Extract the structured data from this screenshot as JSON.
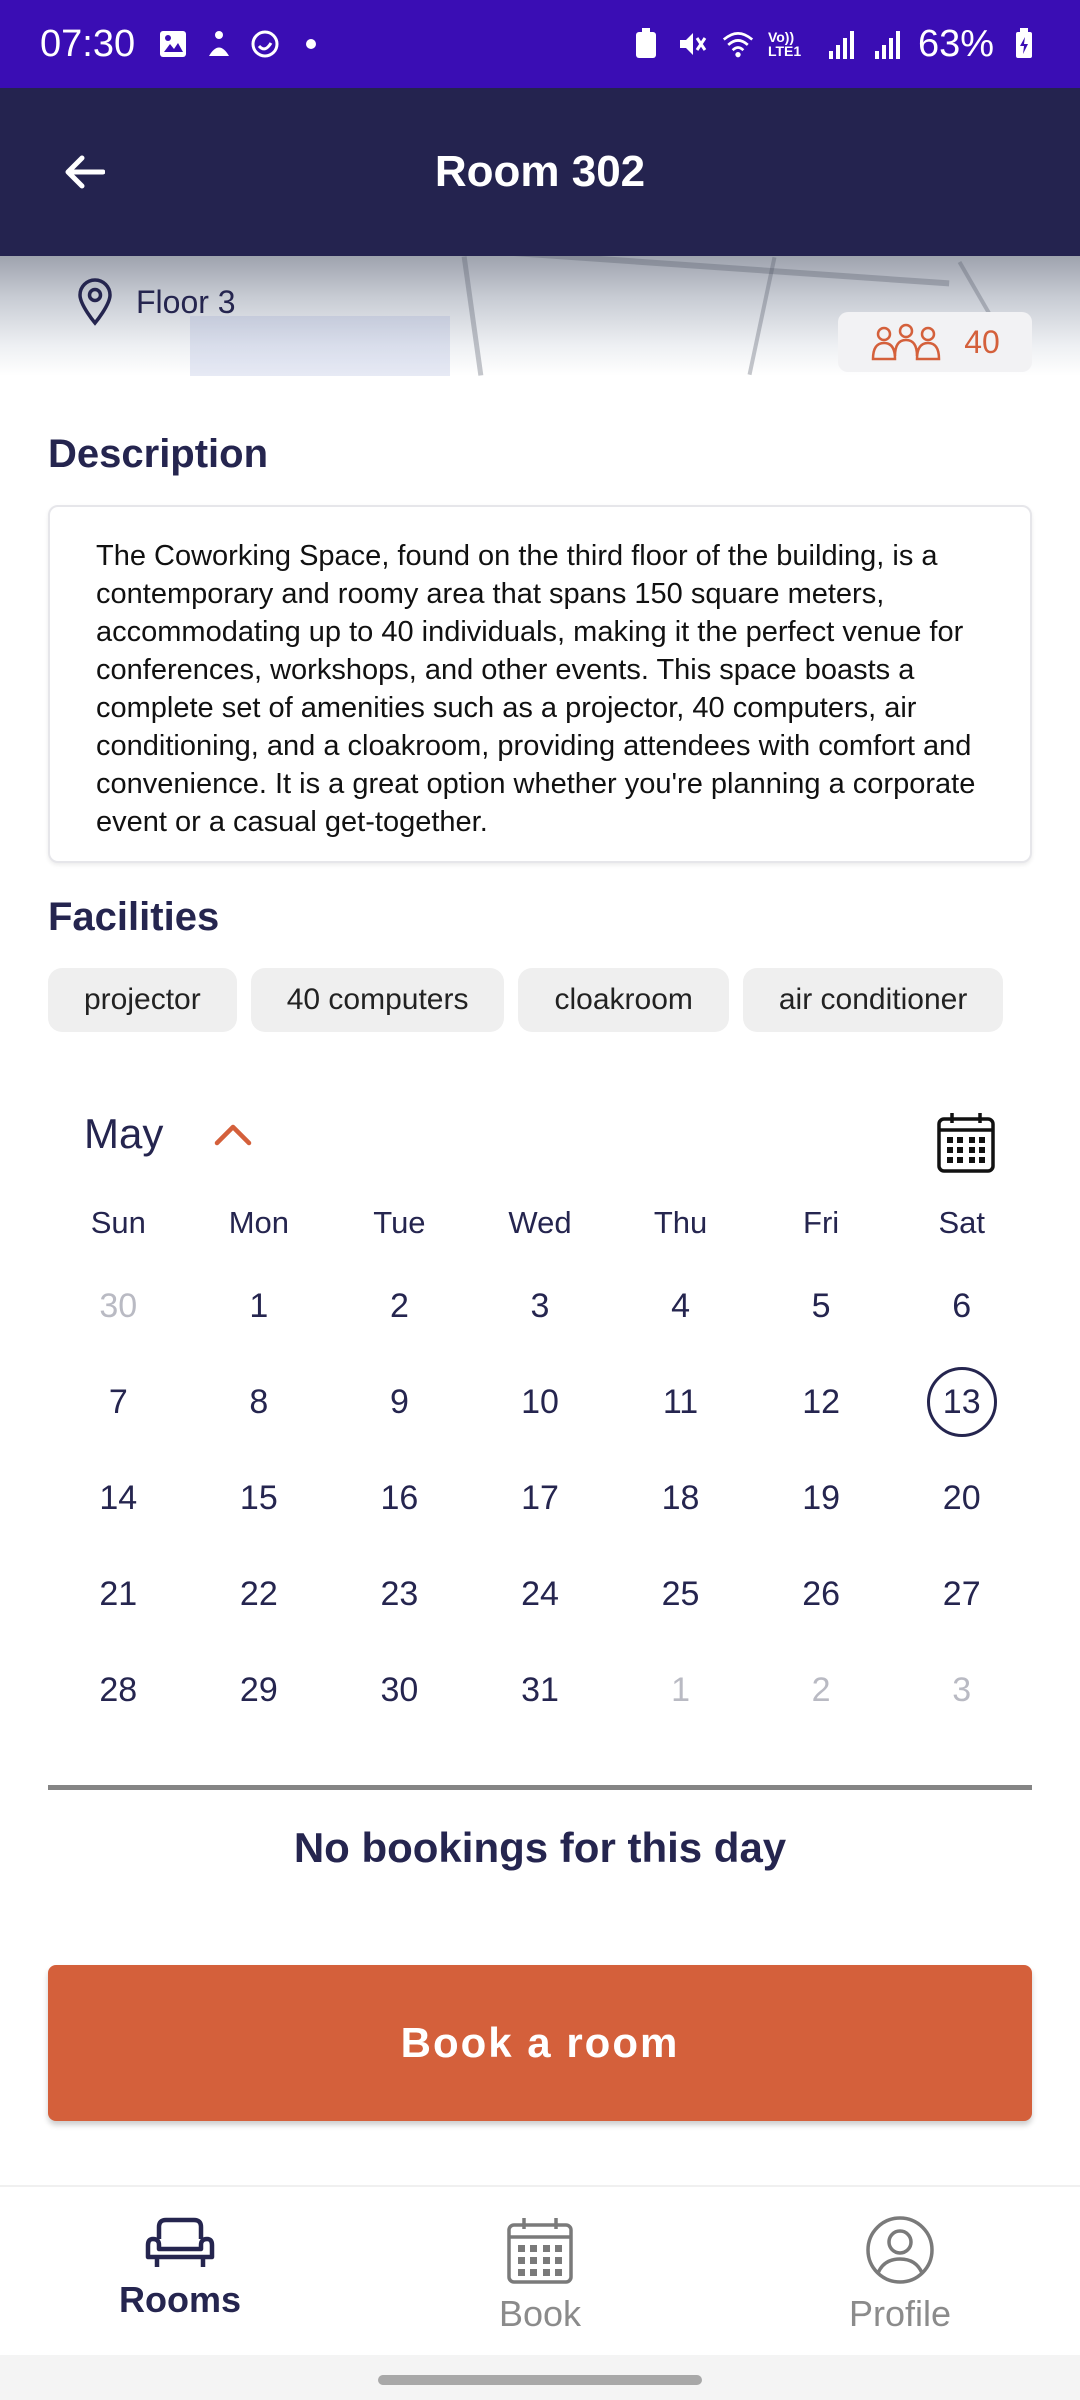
{
  "status_bar": {
    "time": "07:30",
    "battery": "63%",
    "volte_label": "Vo)) LTE1"
  },
  "header": {
    "title": "Room 302"
  },
  "room": {
    "floor": "Floor 3",
    "capacity": "40"
  },
  "description": {
    "title": "Description",
    "text": "The Coworking Space, found on the third floor of the building, is a contemporary and roomy area that spans 150 square meters, accommodating up to 40 individuals, making it the perfect venue for conferences, workshops, and other events. This space boasts a complete set of amenities such as a projector, 40 computers, air conditioning, and a cloakroom, providing attendees with comfort and convenience. It is a great option whether you're planning a corporate event or a casual get-together."
  },
  "facilities": {
    "title": "Facilities",
    "items": [
      "projector",
      "40 computers",
      "cloakroom",
      "air conditioner"
    ]
  },
  "calendar": {
    "month": "May",
    "weekdays": [
      "Sun",
      "Mon",
      "Tue",
      "Wed",
      "Thu",
      "Fri",
      "Sat"
    ],
    "days": [
      {
        "n": "30",
        "muted": true
      },
      {
        "n": "1"
      },
      {
        "n": "2"
      },
      {
        "n": "3"
      },
      {
        "n": "4"
      },
      {
        "n": "5"
      },
      {
        "n": "6"
      },
      {
        "n": "7"
      },
      {
        "n": "8"
      },
      {
        "n": "9"
      },
      {
        "n": "10"
      },
      {
        "n": "11"
      },
      {
        "n": "12"
      },
      {
        "n": "13",
        "selected": true
      },
      {
        "n": "14"
      },
      {
        "n": "15"
      },
      {
        "n": "16"
      },
      {
        "n": "17"
      },
      {
        "n": "18"
      },
      {
        "n": "19"
      },
      {
        "n": "20"
      },
      {
        "n": "21"
      },
      {
        "n": "22"
      },
      {
        "n": "23"
      },
      {
        "n": "24"
      },
      {
        "n": "25"
      },
      {
        "n": "26"
      },
      {
        "n": "27"
      },
      {
        "n": "28"
      },
      {
        "n": "29"
      },
      {
        "n": "30"
      },
      {
        "n": "31"
      },
      {
        "n": "1",
        "muted": true
      },
      {
        "n": "2",
        "muted": true
      },
      {
        "n": "3",
        "muted": true
      }
    ]
  },
  "bookings": {
    "empty_message": "No bookings for this day"
  },
  "actions": {
    "book_label": "Book a room"
  },
  "bottom_nav": {
    "items": [
      {
        "label": "Rooms",
        "icon": "sofa-icon",
        "active": true
      },
      {
        "label": "Book",
        "icon": "calendar-icon",
        "active": false
      },
      {
        "label": "Profile",
        "icon": "user-icon",
        "active": false
      }
    ]
  },
  "colors": {
    "primary": "#24234f",
    "accent": "#d4603b",
    "status_bar": "#3a0db4"
  }
}
